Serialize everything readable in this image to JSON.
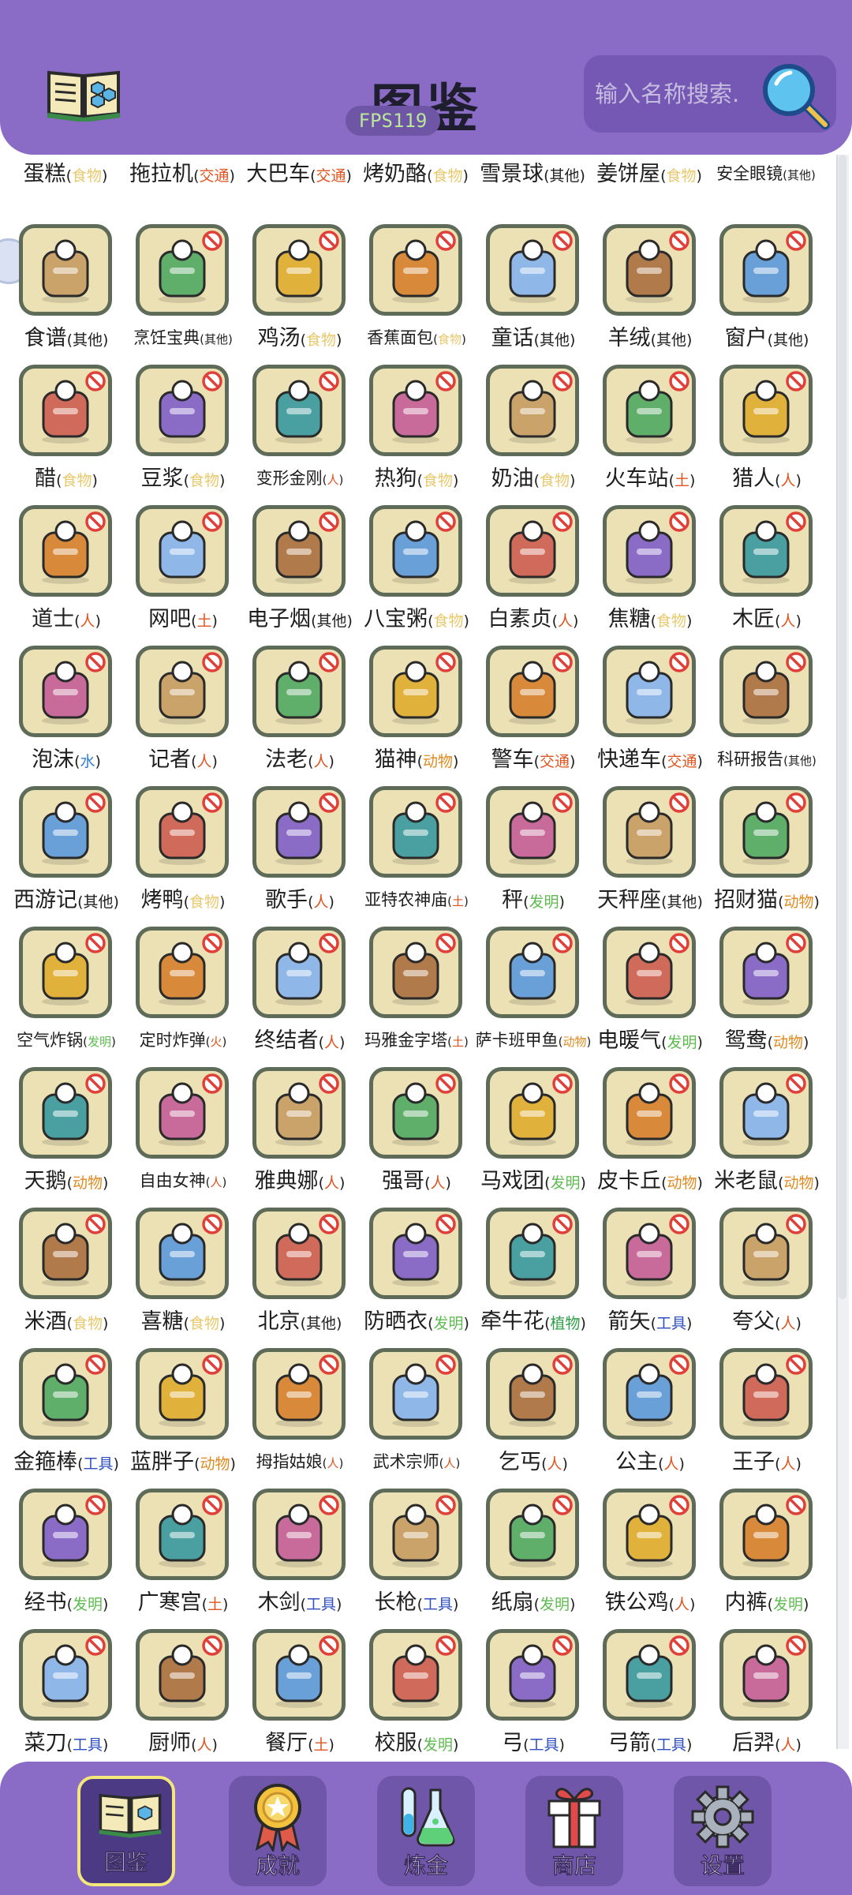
{
  "header": {
    "title": "图鉴",
    "fps": "FPS119",
    "search_placeholder": "输入名称搜索.",
    "icons": {
      "book": "book-icon",
      "search": "magnifier-icon"
    }
  },
  "category_colors": {
    "交通": "#e0541f",
    "其他": "#222222",
    "食物": "#e8c86a",
    "人": "#e0541f",
    "土": "#e0541f",
    "水": "#2f7fd0",
    "动物": "#e08a1f",
    "发明": "#5dbb4f",
    "火": "#e0541f",
    "植物": "#2e9e48",
    "工具": "#2f4fc0"
  },
  "top_row": [
    {
      "name": "蛋糕",
      "category": "食物"
    },
    {
      "name": "拖拉机",
      "category": "交通"
    },
    {
      "name": "大巴车",
      "category": "交通"
    },
    {
      "name": "烤奶酪",
      "category": "食物"
    },
    {
      "name": "雪景球",
      "category": "其他"
    },
    {
      "name": "姜饼屋",
      "category": "食物"
    },
    {
      "name": "安全眼镜",
      "category": "其他"
    }
  ],
  "items": [
    [
      {
        "name": "食谱",
        "category": "其他",
        "icon": "recipe-icon"
      },
      {
        "name": "烹饪宝典",
        "category": "其他",
        "icon": "cookbook-icon"
      },
      {
        "name": "鸡汤",
        "category": "食物",
        "icon": "soup-icon"
      },
      {
        "name": "香蕉面包",
        "category": "食物",
        "icon": "bread-icon"
      },
      {
        "name": "童话",
        "category": "其他",
        "icon": "fairytale-icon"
      },
      {
        "name": "羊绒",
        "category": "其他",
        "icon": "yarn-icon"
      },
      {
        "name": "窗户",
        "category": "其他",
        "icon": "window-icon"
      }
    ],
    [
      {
        "name": "醋",
        "category": "食物",
        "icon": "vinegar-icon"
      },
      {
        "name": "豆浆",
        "category": "食物",
        "icon": "soymilk-icon"
      },
      {
        "name": "变形金刚",
        "category": "人",
        "icon": "robot-icon"
      },
      {
        "name": "热狗",
        "category": "食物",
        "icon": "hotdog-icon"
      },
      {
        "name": "奶油",
        "category": "食物",
        "icon": "cream-icon"
      },
      {
        "name": "火车站",
        "category": "土",
        "icon": "station-icon"
      },
      {
        "name": "猎人",
        "category": "人",
        "icon": "hunter-icon"
      }
    ],
    [
      {
        "name": "道士",
        "category": "人",
        "icon": "taoist-icon"
      },
      {
        "name": "网吧",
        "category": "土",
        "icon": "cafe-icon"
      },
      {
        "name": "电子烟",
        "category": "其他",
        "icon": "vape-icon"
      },
      {
        "name": "八宝粥",
        "category": "食物",
        "icon": "porridge-icon"
      },
      {
        "name": "白素贞",
        "category": "人",
        "icon": "lady-icon"
      },
      {
        "name": "焦糖",
        "category": "食物",
        "icon": "caramel-icon"
      },
      {
        "name": "木匠",
        "category": "人",
        "icon": "carpenter-icon"
      }
    ],
    [
      {
        "name": "泡沫",
        "category": "水",
        "icon": "foam-icon"
      },
      {
        "name": "记者",
        "category": "人",
        "icon": "reporter-icon"
      },
      {
        "name": "法老",
        "category": "人",
        "icon": "pharaoh-icon"
      },
      {
        "name": "猫神",
        "category": "动物",
        "icon": "catgod-icon"
      },
      {
        "name": "警车",
        "category": "交通",
        "icon": "policecar-icon"
      },
      {
        "name": "快递车",
        "category": "交通",
        "icon": "truck-icon"
      },
      {
        "name": "科研报告",
        "category": "其他",
        "icon": "report-icon"
      }
    ],
    [
      {
        "name": "西游记",
        "category": "其他",
        "icon": "xiyouji-icon"
      },
      {
        "name": "烤鸭",
        "category": "食物",
        "icon": "duck-icon"
      },
      {
        "name": "歌手",
        "category": "人",
        "icon": "singer-icon"
      },
      {
        "name": "亚特农神庙",
        "category": "土",
        "icon": "temple-icon"
      },
      {
        "name": "秤",
        "category": "发明",
        "icon": "scale-icon"
      },
      {
        "name": "天秤座",
        "category": "其他",
        "icon": "libra-icon"
      },
      {
        "name": "招财猫",
        "category": "动物",
        "icon": "luckycat-icon"
      }
    ],
    [
      {
        "name": "空气炸锅",
        "category": "发明",
        "icon": "airfryer-icon"
      },
      {
        "name": "定时炸弹",
        "category": "火",
        "icon": "bomb-icon"
      },
      {
        "name": "终结者",
        "category": "人",
        "icon": "terminator-icon"
      },
      {
        "name": "玛雅金字塔",
        "category": "土",
        "icon": "pyramid-icon"
      },
      {
        "name": "萨卡班甲鱼",
        "category": "动物",
        "icon": "fish-icon"
      },
      {
        "name": "电暖气",
        "category": "发明",
        "icon": "heater-icon"
      },
      {
        "name": "鸳鸯",
        "category": "动物",
        "icon": "mandarinduck-icon"
      }
    ],
    [
      {
        "name": "天鹅",
        "category": "动物",
        "icon": "swan-icon"
      },
      {
        "name": "自由女神",
        "category": "人",
        "icon": "liberty-icon"
      },
      {
        "name": "雅典娜",
        "category": "人",
        "icon": "athena-icon"
      },
      {
        "name": "强哥",
        "category": "人",
        "icon": "man-icon"
      },
      {
        "name": "马戏团",
        "category": "发明",
        "icon": "circus-icon"
      },
      {
        "name": "皮卡丘",
        "category": "动物",
        "icon": "pikachu-icon"
      },
      {
        "name": "米老鼠",
        "category": "动物",
        "icon": "mickey-icon"
      }
    ],
    [
      {
        "name": "米酒",
        "category": "食物",
        "icon": "ricewine-icon"
      },
      {
        "name": "喜糖",
        "category": "食物",
        "icon": "candy-icon"
      },
      {
        "name": "北京",
        "category": "其他",
        "icon": "beijing-icon"
      },
      {
        "name": "防晒衣",
        "category": "发明",
        "icon": "jacket-icon"
      },
      {
        "name": "牵牛花",
        "category": "植物",
        "icon": "flower-icon"
      },
      {
        "name": "箭矢",
        "category": "工具",
        "icon": "arrow-icon"
      },
      {
        "name": "夸父",
        "category": "人",
        "icon": "kuafu-icon"
      }
    ],
    [
      {
        "name": "金箍棒",
        "category": "工具",
        "icon": "staff-icon"
      },
      {
        "name": "蓝胖子",
        "category": "动物",
        "icon": "doraemon-icon"
      },
      {
        "name": "拇指姑娘",
        "category": "人",
        "icon": "thumbelina-icon"
      },
      {
        "name": "武术宗师",
        "category": "人",
        "icon": "kungfu-icon"
      },
      {
        "name": "乞丐",
        "category": "人",
        "icon": "beggar-icon"
      },
      {
        "name": "公主",
        "category": "人",
        "icon": "princess-icon"
      },
      {
        "name": "王子",
        "category": "人",
        "icon": "prince-icon"
      }
    ],
    [
      {
        "name": "经书",
        "category": "发明",
        "icon": "scripture-icon"
      },
      {
        "name": "广寒宫",
        "category": "土",
        "icon": "palace-icon"
      },
      {
        "name": "木剑",
        "category": "工具",
        "icon": "sword-icon"
      },
      {
        "name": "长枪",
        "category": "工具",
        "icon": "spear-icon"
      },
      {
        "name": "纸扇",
        "category": "发明",
        "icon": "fan-icon"
      },
      {
        "name": "铁公鸡",
        "category": "人",
        "icon": "rooster-icon"
      },
      {
        "name": "内裤",
        "category": "发明",
        "icon": "underwear-icon"
      }
    ],
    [
      {
        "name": "菜刀",
        "category": "工具",
        "icon": "cleaver-icon"
      },
      {
        "name": "厨师",
        "category": "人",
        "icon": "chef-icon"
      },
      {
        "name": "餐厅",
        "category": "土",
        "icon": "restaurant-icon"
      },
      {
        "name": "校服",
        "category": "发明",
        "icon": "uniform-icon"
      },
      {
        "name": "弓",
        "category": "工具",
        "icon": "bow-icon"
      },
      {
        "name": "弓箭",
        "category": "工具",
        "icon": "crossbow-icon"
      },
      {
        "name": "后羿",
        "category": "人",
        "icon": "houyi-icon"
      }
    ]
  ],
  "bottom_nav": [
    {
      "label": "图鉴",
      "icon": "book-icon",
      "active": true
    },
    {
      "label": "成就",
      "icon": "medal-icon",
      "active": false
    },
    {
      "label": "炼金",
      "icon": "flask-icon",
      "active": false
    },
    {
      "label": "商店",
      "icon": "gift-icon",
      "active": false
    },
    {
      "label": "设置",
      "icon": "gear-icon",
      "active": false
    }
  ]
}
